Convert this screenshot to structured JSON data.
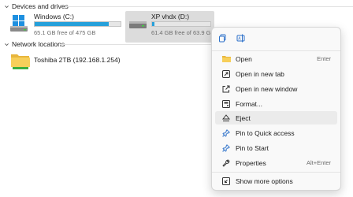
{
  "sections": {
    "devices_header": "Devices and drives",
    "network_header": "Network locations"
  },
  "drives": [
    {
      "name": "Windows (C:)",
      "free_text": "65.1 GB free of 475 GB",
      "used_fraction": 0.86
    },
    {
      "name": "XP vhdx (D:)",
      "free_text": "61.4 GB free of 63.9 GB",
      "used_fraction": 0.04
    }
  ],
  "network": [
    {
      "name": "Toshiba 2TB (192.168.1.254)"
    }
  ],
  "context_menu": {
    "top_icons": [
      "copy-icon",
      "rename-icon"
    ],
    "items": [
      {
        "label": "Open",
        "shortcut": "Enter",
        "icon": "folder-icon"
      },
      {
        "label": "Open in new tab",
        "shortcut": "",
        "icon": "new-tab-icon"
      },
      {
        "label": "Open in new window",
        "shortcut": "",
        "icon": "new-window-icon"
      },
      {
        "label": "Format...",
        "shortcut": "",
        "icon": "format-icon"
      },
      {
        "label": "Eject",
        "shortcut": "",
        "icon": "eject-icon"
      },
      {
        "label": "Pin to Quick access",
        "shortcut": "",
        "icon": "pin-icon"
      },
      {
        "label": "Pin to Start",
        "shortcut": "",
        "icon": "pin-icon"
      },
      {
        "label": "Properties",
        "shortcut": "Alt+Enter",
        "icon": "wrench-icon"
      },
      {
        "label": "Show more options",
        "shortcut": "",
        "icon": "more-options-icon"
      }
    ]
  },
  "colors": {
    "accent": "#26a0da",
    "selected_bg": "#dcdcdc",
    "menu_bg": "#f9f9f9",
    "hover_bg": "#ebebeb"
  }
}
